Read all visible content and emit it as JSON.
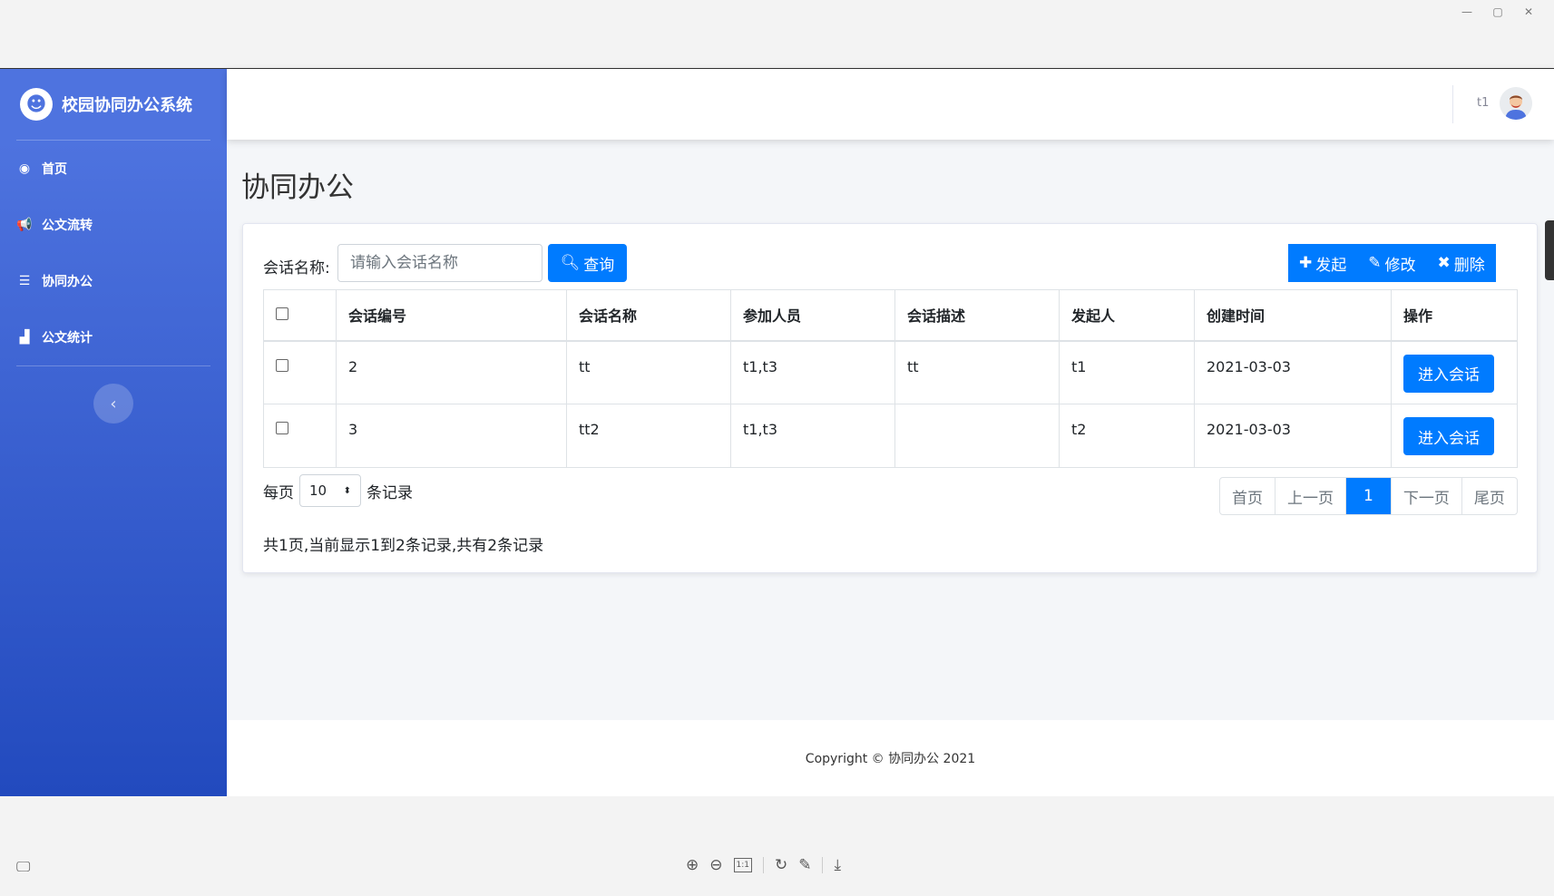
{
  "app": {
    "brand": "校园协同办公系统",
    "brand_logo_glyph": "☻",
    "user": "t1",
    "footer": "Copyright © 协同办公 2021"
  },
  "sidebar": {
    "items": [
      {
        "label": "首页",
        "icon": "dashboard-icon",
        "glyph": "◉"
      },
      {
        "label": "公文流转",
        "icon": "bullhorn-icon",
        "glyph": "📢"
      },
      {
        "label": "协同办公",
        "icon": "server-icon",
        "glyph": "☰"
      },
      {
        "label": "公文统计",
        "icon": "chart-area-icon",
        "glyph": "▟"
      }
    ],
    "toggle_glyph": "‹"
  },
  "page": {
    "title": "协同办公",
    "search_label": "会话名称:",
    "search_placeholder": "请输入会话名称",
    "search_button": "查询",
    "actions": {
      "create": "发起",
      "edit": "修改",
      "delete": "删除"
    }
  },
  "table": {
    "headers": [
      "会话编号",
      "会话名称",
      "参加人员",
      "会话描述",
      "发起人",
      "创建时间",
      "操作"
    ],
    "rows": [
      {
        "id": "2",
        "name": "tt",
        "members": "t1,t3",
        "desc": "tt",
        "creator": "t1",
        "created": "2021-03-03",
        "action": "进入会话"
      },
      {
        "id": "3",
        "name": "tt2",
        "members": "t1,t3",
        "desc": "",
        "creator": "t2",
        "created": "2021-03-03",
        "action": "进入会话"
      }
    ]
  },
  "pagination": {
    "per_page_prefix": "每页",
    "per_page_value": "10",
    "per_page_suffix": "条记录",
    "first": "首页",
    "prev": "上一页",
    "current": "1",
    "next": "下一页",
    "last": "尾页",
    "summary": "共1页,当前显示1到2条记录,共有2条记录"
  },
  "colors": {
    "sidebar_top": "#4e73df",
    "sidebar_bottom": "#224abe",
    "primary": "#007bff"
  }
}
